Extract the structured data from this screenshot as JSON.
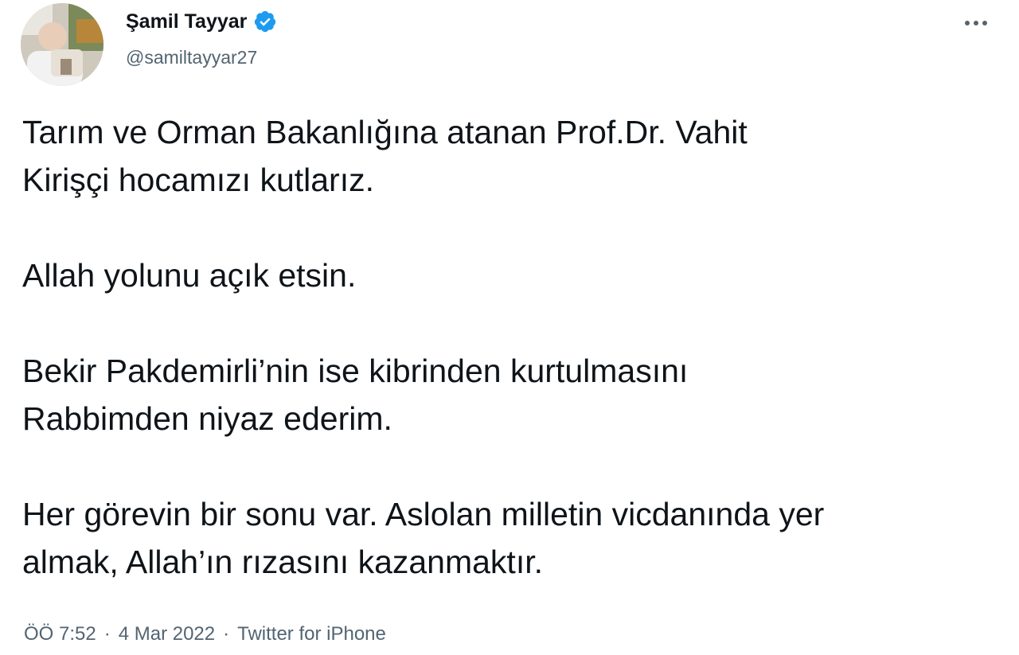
{
  "tweet": {
    "author": {
      "display_name": "Şamil Tayyar",
      "handle": "@samiltayyar27",
      "verified": true,
      "verified_color": "#1d9bf0"
    },
    "more_icon": "more-horizontal-icon",
    "paragraphs": [
      {
        "lines": [
          "Tarım ve Orman Bakanlığına atanan Prof.Dr. Vahit",
          "Kirişçi hocamızı kutlarız."
        ]
      },
      {
        "lines": [
          "Allah yolunu açık etsin."
        ]
      },
      {
        "lines": [
          "Bekir Pakdemirli’nin ise kibrinden kurtulmasını",
          "Rabbimden niyaz ederim."
        ]
      },
      {
        "lines": [
          "Her görevin bir sonu var. Aslolan milletin vicdanında yer",
          "almak, Allah’ın rızasını kazanmaktır."
        ]
      }
    ],
    "meta": {
      "time": "ÖÖ 7:52",
      "date": "4 Mar 2022",
      "source": "Twitter for iPhone",
      "separator": "·"
    }
  }
}
